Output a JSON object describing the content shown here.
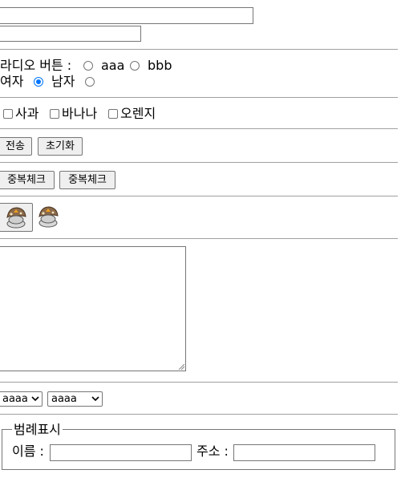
{
  "radio_row": {
    "label": "라디오 버튼 :",
    "options": [
      "aaa",
      "bbb"
    ]
  },
  "gender_row": {
    "female_label": "여자",
    "male_label": "남자"
  },
  "fruit_checkboxes": [
    "사과",
    "바나나",
    "오렌지"
  ],
  "form_buttons": {
    "submit_label": "전송",
    "reset_label": "초기화"
  },
  "duplicate_buttons": [
    "중복체크",
    "중복체크"
  ],
  "image_buttons": [
    "mushroom-icon",
    "mushroom-icon"
  ],
  "selects": [
    {
      "selected": "aaaa"
    },
    {
      "selected": "aaaa"
    }
  ],
  "fieldset": {
    "legend": "범례표시",
    "name_label": "이름 :",
    "address_label": "주소 :"
  },
  "colors": {
    "radio_checked": "#0075ff",
    "control_border": "#767676",
    "button_bg": "#efefef"
  }
}
